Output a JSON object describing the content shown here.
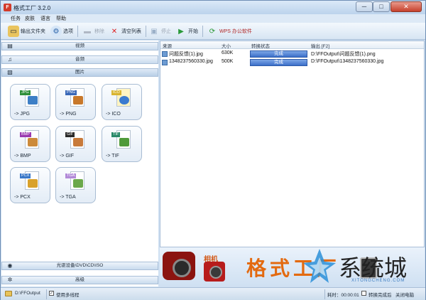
{
  "window": {
    "title": "格式工厂 3.2.0",
    "min": "─",
    "max": "□",
    "close": "✕"
  },
  "menu": [
    "任务",
    "皮肤",
    "语言",
    "帮助"
  ],
  "toolbar": {
    "output_folder": "输出文件夹",
    "options": "选项",
    "remove": "移除",
    "clear_list": "清空列表",
    "stop": "停止",
    "start": "开始",
    "wps": "WPS 办公软件"
  },
  "categories": {
    "video": "视频",
    "audio": "音频",
    "picture": "图片",
    "dvd": "光驱设备\\DVD\\CD\\ISO",
    "advanced": "高级"
  },
  "formats": [
    {
      "badge": "JPG",
      "label": "-> JPG",
      "badge_color": "#2f8f3a",
      "pic_color": "#3d7fc6"
    },
    {
      "badge": "PNG",
      "label": "-> PNG",
      "badge_color": "#3a68b8",
      "pic_color": "#c8782a"
    },
    {
      "badge": "ICO",
      "label": "-> ICO",
      "badge_color": "#d9b530",
      "pic_color": "#3b7bd0"
    },
    {
      "badge": "BMP",
      "label": "-> BMP",
      "badge_color": "#9a3ab0",
      "pic_color": "#cc8a3a"
    },
    {
      "badge": "GIF",
      "label": "-> GIF",
      "badge_color": "#2a2a2a",
      "pic_color": "#c87a3a"
    },
    {
      "badge": "TIF",
      "label": "-> TIF",
      "badge_color": "#2a8a6a",
      "pic_color": "#4f9a3a"
    },
    {
      "badge": "PCX",
      "label": "-> PCX",
      "badge_color": "#3a78c8",
      "pic_color": "#d9a12a"
    },
    {
      "badge": "TGA",
      "label": "-> TGA",
      "badge_color": "#b28ad8",
      "pic_color": "#6aa84a"
    }
  ],
  "table": {
    "headers": {
      "source": "来源",
      "size": "大小",
      "status": "转换状态",
      "output": "输出 [F2]"
    },
    "rows": [
      {
        "source": "问题反馈(1).jpg",
        "size": "630K",
        "status": "完成",
        "output": "D:\\FFOutput\\问题反馈(1).png"
      },
      {
        "source": "1348237560330.jpg",
        "size": "500K",
        "status": "完成",
        "output": "D:\\FFOutput\\1348237560330.jpg"
      }
    ]
  },
  "banner": {
    "camera_label": "相机",
    "title": "格式工厂",
    "watermark": "系统城",
    "watermark_url": "XITONGCHENG.COM"
  },
  "statusbar": {
    "output_path": "D:\\FFOutput",
    "multithread": "使用多线程",
    "multithread_checked": "✓",
    "elapsed": "耗时：00:00:01",
    "after_convert": "转换完成后",
    "shutdown": "关闭电脑"
  }
}
